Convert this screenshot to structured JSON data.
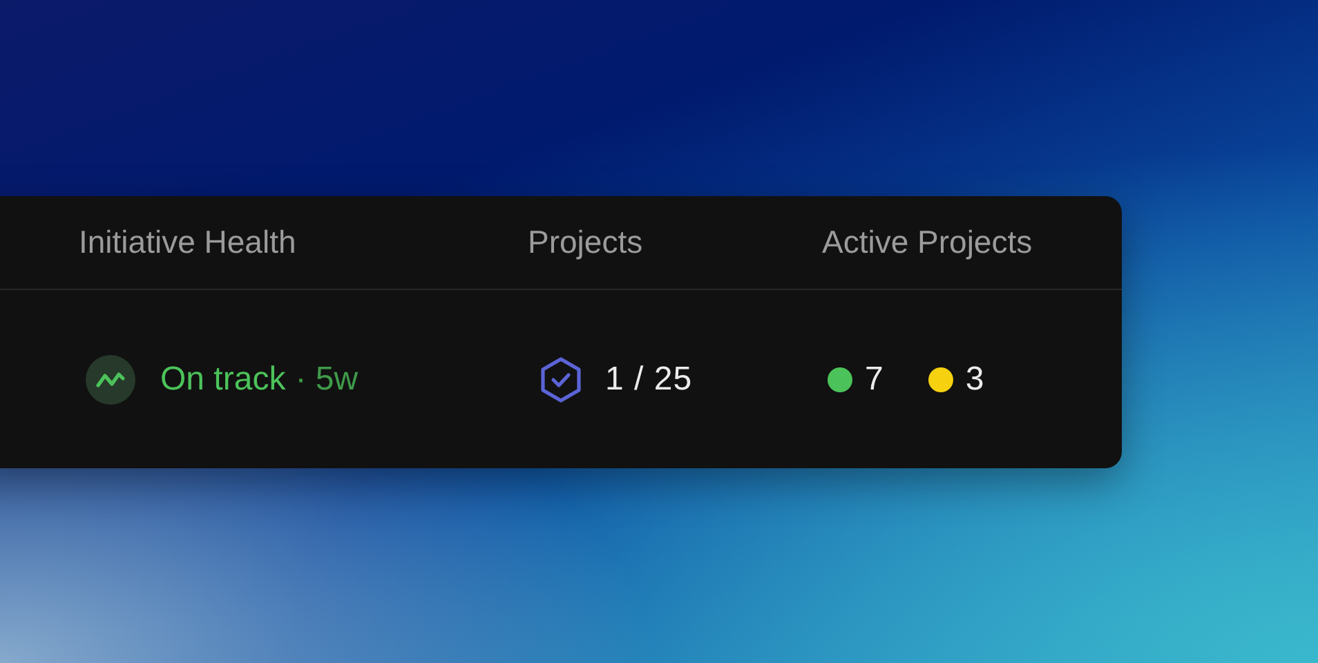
{
  "table": {
    "columns": [
      "Initiative Health",
      "Projects",
      "Active Projects"
    ],
    "row": {
      "health": {
        "status": "On track",
        "detail": "· 5w"
      },
      "projects": "1 / 25",
      "active_projects": [
        {
          "color": "#4cc35a",
          "count": "7"
        },
        {
          "color": "#f5d10f",
          "count": "3"
        }
      ]
    }
  }
}
